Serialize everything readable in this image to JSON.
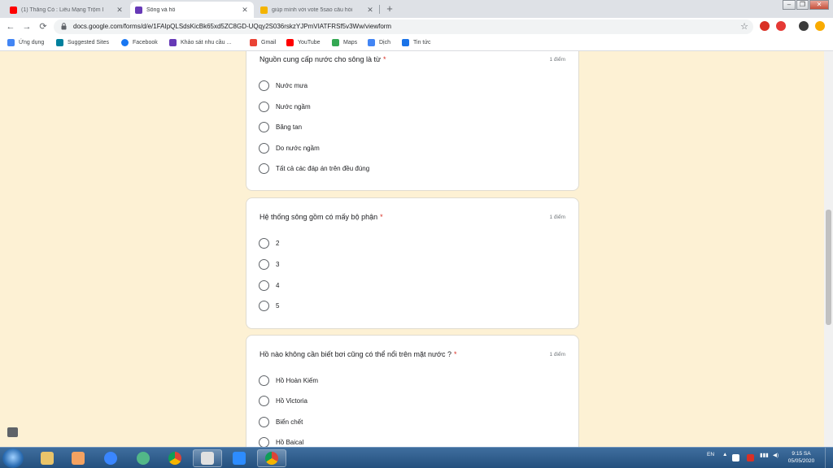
{
  "browser": {
    "tabs": [
      {
        "title": "(1) Thằng Cò : Liêu Mạng Trộm I",
        "icon": "youtube-icon",
        "active": false
      },
      {
        "title": "Sông và hồ",
        "icon": "google-forms-icon",
        "active": true
      },
      {
        "title": "giúp mình với vote 5sao câu hỏi",
        "icon": "hoc24-icon",
        "active": false
      }
    ],
    "close_glyph": "✕",
    "new_tab_glyph": "+",
    "window_controls": [
      "–",
      "❐",
      "✕"
    ],
    "back_glyph": "←",
    "forward_glyph": "→",
    "reload_glyph": "⟳",
    "url": "docs.google.com/forms/d/e/1FAIpQLSdsKicBk65xd5ZC8GD-UQqy2S036rskzYJPmVIATFRSf5v3Ww/viewform",
    "star_glyph": "☆",
    "menu_glyph": "⋮"
  },
  "bookmarks": [
    {
      "label": "Ứng dụng",
      "icon": "apps-grid-icon",
      "color": "#4285f4"
    },
    {
      "label": "Suggested Sites",
      "icon": "bing-icon",
      "color": "#00809d"
    },
    {
      "label": "Facebook",
      "icon": "facebook-icon",
      "color": "#1877f2"
    },
    {
      "label": "Khảo sát nhu cầu ...",
      "icon": "google-forms-icon",
      "color": "#673ab7"
    },
    {
      "label": "Gmail",
      "icon": "gmail-icon",
      "color": "#ea4335"
    },
    {
      "label": "YouTube",
      "icon": "youtube-icon",
      "color": "#ff0000"
    },
    {
      "label": "Maps",
      "icon": "maps-icon",
      "color": "#34a853"
    },
    {
      "label": "Dịch",
      "icon": "translate-icon",
      "color": "#4285f4"
    },
    {
      "label": "Tin tức",
      "icon": "news-icon",
      "color": "#1a73e8"
    }
  ],
  "form": {
    "questions": [
      {
        "title": "Nguồn cung cấp nước cho sông là từ",
        "required_mark": "*",
        "points": "1 điểm",
        "options": [
          "Nước mưa",
          "Nước ngầm",
          "Băng tan",
          "Do nước ngầm",
          "Tất cả các đáp án trên đều đúng"
        ]
      },
      {
        "title": "Hệ thống sông gồm có mấy bộ phận",
        "required_mark": "*",
        "points": "1 điểm",
        "options": [
          "2",
          "3",
          "4",
          "5"
        ]
      },
      {
        "title": "Hồ nào không cần biết bơi cũng có thể nổi trên mặt nước ?",
        "required_mark": "*",
        "points": "1 điểm",
        "options": [
          "Hồ Hoàn Kiếm",
          "Hồ Victoria",
          "Biển chết",
          "Hồ Baical"
        ]
      }
    ],
    "colors": {
      "background": "#fdf1d4",
      "required": "#d93025"
    }
  },
  "taskbar": {
    "pinned": [
      {
        "name": "explorer",
        "icon": "folder-icon",
        "color": "#e9c46a"
      },
      {
        "name": "media player",
        "icon": "media-player-icon",
        "color": "#f4a261"
      },
      {
        "name": "internet explorer",
        "icon": "ie-icon",
        "color": "#3a86ff"
      },
      {
        "name": "coccoc",
        "icon": "coccoc-icon",
        "color": "#52b788"
      },
      {
        "name": "chrome",
        "icon": "chrome-icon",
        "color": "#db4437"
      },
      {
        "name": "notepad",
        "icon": "notepad-icon",
        "color": "#e0e0e0"
      },
      {
        "name": "zoom",
        "icon": "zoom-icon",
        "color": "#2d8cff"
      },
      {
        "name": "chrome running",
        "icon": "chrome-icon",
        "color": "#db4437"
      }
    ],
    "language": "EN",
    "time": "9:15 SA",
    "date": "05/05/2020"
  }
}
